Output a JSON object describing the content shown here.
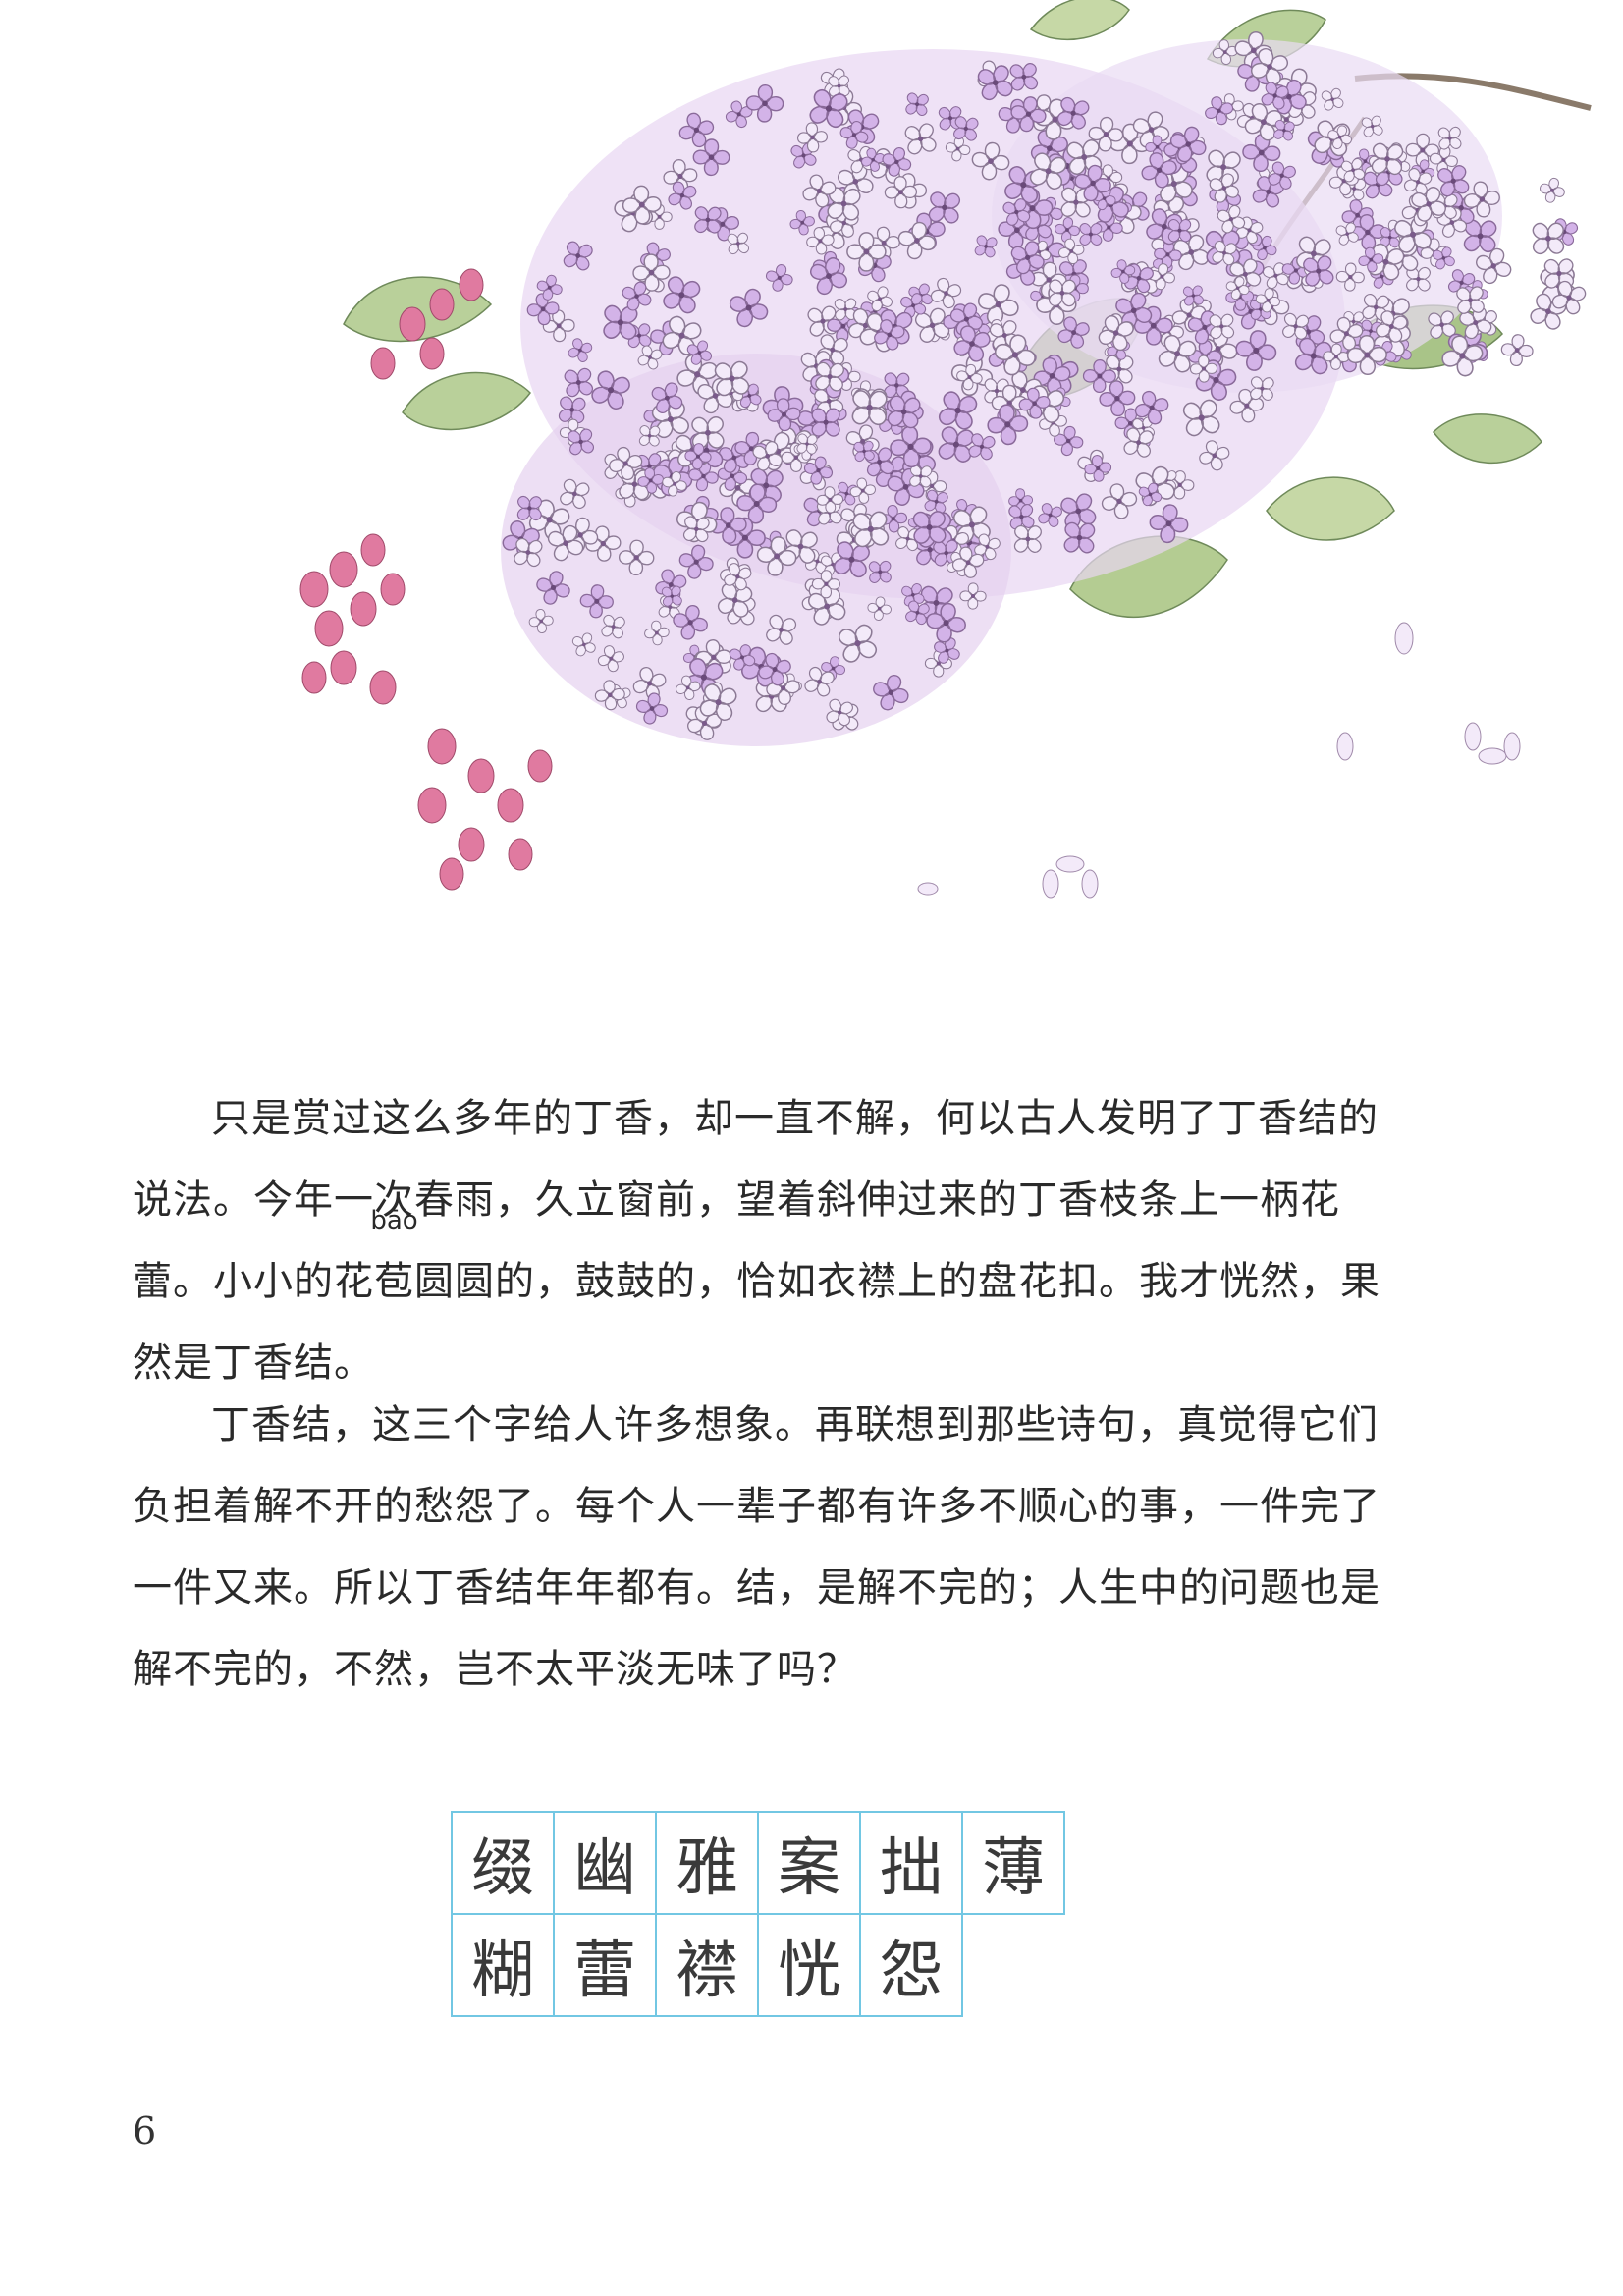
{
  "illustration": {
    "subject": "lilac-flowers-illustration",
    "colors": {
      "blossom": "#c9a6e0",
      "blossom_light": "#f2e8f8",
      "bud": "#e07aa0",
      "leaf": "#a9c488",
      "leaf_dark": "#7f9f6a",
      "branch": "#8a7a6a"
    }
  },
  "text": {
    "p1_before_ruby": "只是赏过这么多年的丁香，却一直不解，何以古人发明了丁香结的说法。今年一次春雨，久立窗前，望着斜伸过来的丁香枝条上一柄花蕾。小小的花",
    "ruby_base": "苞",
    "ruby_pinyin": "bāo",
    "p1_after_ruby": "圆圆的，鼓鼓的，恰如衣襟上的盘花扣。我才恍然，果然是丁香结。",
    "p2": "丁香结，这三个字给人许多想象。再联想到那些诗句，真觉得它们负担着解不开的愁怨了。每个人一辈子都有许多不顺心的事，一件完了一件又来。所以丁香结年年都有。结，是解不完的；人生中的问题也是解不完的，不然，岂不太平淡无味了吗？"
  },
  "vocab_characters": {
    "row1": [
      "缀",
      "幽",
      "雅",
      "案",
      "拙",
      "薄"
    ],
    "row2": [
      "糊",
      "蕾",
      "襟",
      "恍",
      "怨"
    ]
  },
  "page_number": "6"
}
